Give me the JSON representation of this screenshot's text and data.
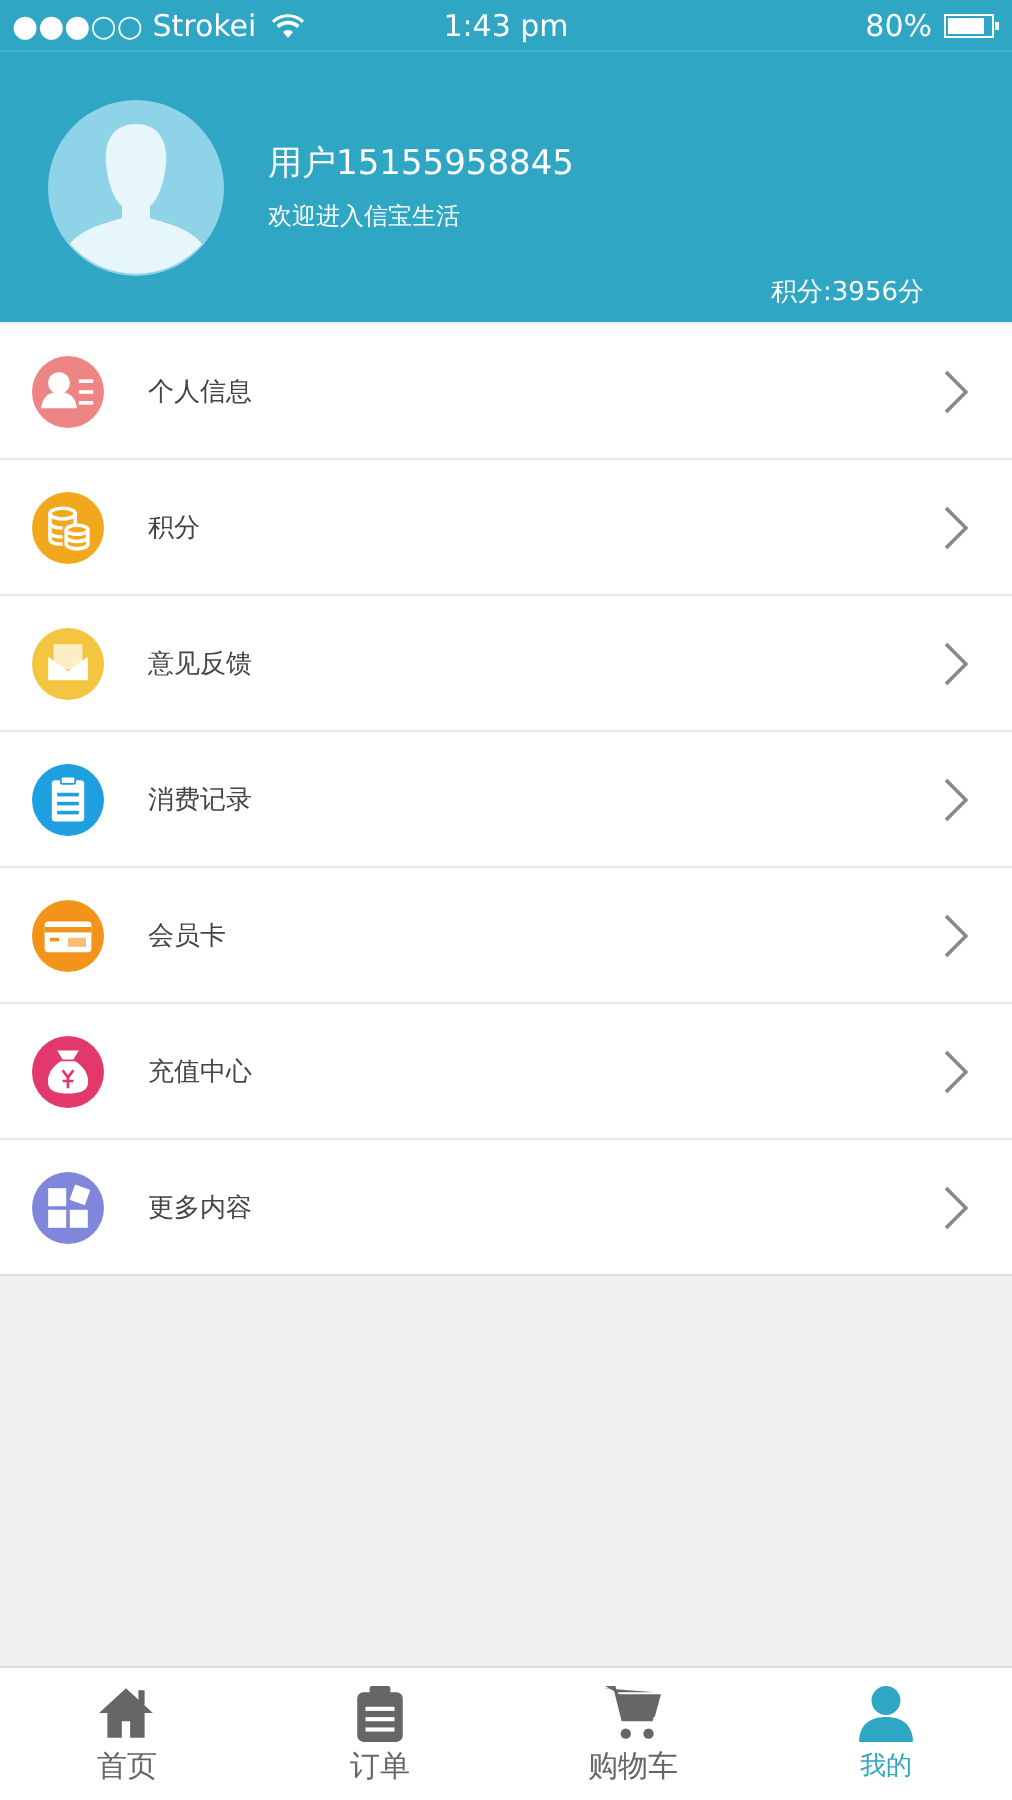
{
  "status_bar": {
    "carrier": "●●●○○ Strokei",
    "time": "1:43 pm",
    "battery": "80%"
  },
  "profile": {
    "name": "用户15155958845",
    "welcome": "欢迎进入信宝生活",
    "points": "积分:3956分"
  },
  "menu": [
    {
      "label": "个人信息",
      "kind": "person",
      "color": "#ee8585"
    },
    {
      "label": "积分",
      "kind": "coins",
      "color": "#f2a81c"
    },
    {
      "label": "意见反馈",
      "kind": "mail",
      "color": "#f4c53e"
    },
    {
      "label": "消费记录",
      "kind": "clipboard",
      "color": "#1e9fe0"
    },
    {
      "label": "会员卡",
      "kind": "card",
      "color": "#f39319"
    },
    {
      "label": "充值中心",
      "kind": "bag",
      "color": "#e2386b"
    },
    {
      "label": "更多内容",
      "kind": "grid",
      "color": "#7f86dc"
    }
  ],
  "tabs": [
    {
      "label": "首页",
      "kind": "home",
      "selected": false
    },
    {
      "label": "订单",
      "kind": "clipboard",
      "selected": false
    },
    {
      "label": "购物车",
      "kind": "cart",
      "selected": false
    },
    {
      "label": "我的",
      "kind": "person",
      "selected": true
    }
  ]
}
